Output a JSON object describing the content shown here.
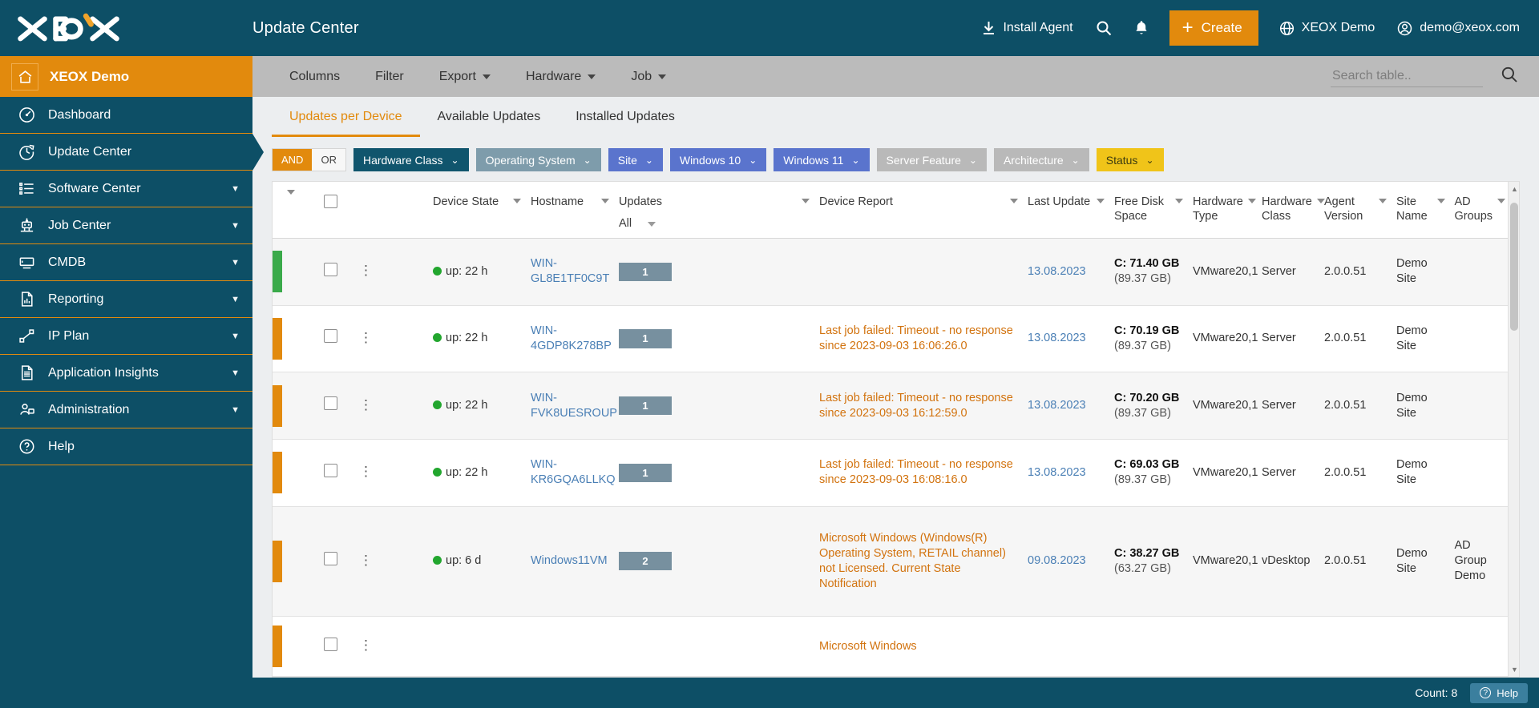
{
  "header": {
    "logo_text": "XEOX",
    "app_title": "Update Center",
    "install_agent": "Install Agent",
    "search_icon": "search-icon",
    "bell_icon": "notifications-icon",
    "create_label": "Create",
    "tenant_label": "XEOX Demo",
    "user_label": "demo@xeox.com"
  },
  "sidebar": {
    "tenant": "XEOX Demo",
    "items": [
      {
        "label": "Dashboard",
        "icon": "gauge-icon",
        "expandable": false,
        "active": false
      },
      {
        "label": "Update Center",
        "icon": "clock-refresh-icon",
        "expandable": false,
        "active": true
      },
      {
        "label": "Software Center",
        "icon": "list-icon",
        "expandable": true,
        "active": false
      },
      {
        "label": "Job Center",
        "icon": "robot-icon",
        "expandable": true,
        "active": false
      },
      {
        "label": "CMDB",
        "icon": "monitor-icon",
        "expandable": true,
        "active": false
      },
      {
        "label": "Reporting",
        "icon": "report-chart-icon",
        "expandable": true,
        "active": false
      },
      {
        "label": "IP Plan",
        "icon": "network-icon",
        "expandable": true,
        "active": false
      },
      {
        "label": "Application Insights",
        "icon": "document-icon",
        "expandable": true,
        "active": false
      },
      {
        "label": "Administration",
        "icon": "user-config-icon",
        "expandable": true,
        "active": false
      },
      {
        "label": "Help",
        "icon": "question-icon",
        "expandable": false,
        "active": false
      }
    ]
  },
  "toolbar": {
    "buttons": [
      {
        "label": "Columns",
        "caret": false
      },
      {
        "label": "Filter",
        "caret": false
      },
      {
        "label": "Export",
        "caret": true
      },
      {
        "label": "Hardware",
        "caret": true
      },
      {
        "label": "Job",
        "caret": true
      }
    ],
    "search_placeholder": "Search table..",
    "search_value": ""
  },
  "tabs": [
    {
      "label": "Updates per Device",
      "active": true
    },
    {
      "label": "Available Updates",
      "active": false
    },
    {
      "label": "Installed Updates",
      "active": false
    }
  ],
  "filters": {
    "and_label": "AND",
    "or_label": "OR",
    "active_operator": "AND",
    "chips": [
      {
        "label": "Hardware Class",
        "color": "#10556d"
      },
      {
        "label": "Operating System",
        "color": "#7e9cab"
      },
      {
        "label": "Site",
        "color": "#5a74cd"
      },
      {
        "label": "Windows 10",
        "color": "#5a74cd"
      },
      {
        "label": "Windows 11",
        "color": "#5a74cd"
      },
      {
        "label": "Server Feature",
        "color": "#b9b9b9"
      },
      {
        "label": "Architecture",
        "color": "#b9b9b9"
      },
      {
        "label": "Status",
        "color": "#f0c419"
      }
    ]
  },
  "table": {
    "columns": [
      {
        "label": "Device State",
        "caret": true
      },
      {
        "label": "Hostname",
        "caret": true
      },
      {
        "label": "Updates",
        "caret": true,
        "sub_value": "All",
        "sub_caret": true
      },
      {
        "label": "Device Report",
        "caret": true
      },
      {
        "label": "Last Update",
        "caret": true
      },
      {
        "label": "Free Disk Space",
        "caret": true
      },
      {
        "label": "Hardware Type",
        "caret": true
      },
      {
        "label": "Hardware Class",
        "caret": true
      },
      {
        "label": "Agent Version",
        "caret": true
      },
      {
        "label": "Site Name",
        "caret": true
      },
      {
        "label": "AD Groups",
        "caret": true
      }
    ],
    "rows": [
      {
        "state_color": "#3aaa4a",
        "status_dot": "#22a62e",
        "device_state": "up: 22 h",
        "hostname": "WIN-GL8E1TF0C9T",
        "updates": "1",
        "device_report": "",
        "last_update": "13.08.2023",
        "disk_used": "C: 71.40 GB",
        "disk_total": "(89.37 GB)",
        "hardware_type": "VMware20,1",
        "hardware_class": "Server",
        "agent_version": "2.0.0.51",
        "site_name": "Demo Site",
        "ad_groups": ""
      },
      {
        "state_color": "#e28a0d",
        "status_dot": "#22a62e",
        "device_state": "up: 22 h",
        "hostname": "WIN-4GDP8K278BP",
        "updates": "1",
        "device_report": "Last job failed: Timeout - no response since 2023-09-03 16:06:26.0",
        "last_update": "13.08.2023",
        "disk_used": "C: 70.19 GB",
        "disk_total": "(89.37 GB)",
        "hardware_type": "VMware20,1",
        "hardware_class": "Server",
        "agent_version": "2.0.0.51",
        "site_name": "Demo Site",
        "ad_groups": ""
      },
      {
        "state_color": "#e28a0d",
        "status_dot": "#22a62e",
        "device_state": "up: 22 h",
        "hostname": "WIN-FVK8UESROUP",
        "updates": "1",
        "device_report": "Last job failed: Timeout - no response since 2023-09-03 16:12:59.0",
        "last_update": "13.08.2023",
        "disk_used": "C: 70.20 GB",
        "disk_total": "(89.37 GB)",
        "hardware_type": "VMware20,1",
        "hardware_class": "Server",
        "agent_version": "2.0.0.51",
        "site_name": "Demo Site",
        "ad_groups": ""
      },
      {
        "state_color": "#e28a0d",
        "status_dot": "#22a62e",
        "device_state": "up: 22 h",
        "hostname": "WIN-KR6GQA6LLKQ",
        "updates": "1",
        "device_report": "Last job failed: Timeout - no response since 2023-09-03 16:08:16.0",
        "last_update": "13.08.2023",
        "disk_used": "C: 69.03 GB",
        "disk_total": "(89.37 GB)",
        "hardware_type": "VMware20,1",
        "hardware_class": "Server",
        "agent_version": "2.0.0.51",
        "site_name": "Demo Site",
        "ad_groups": ""
      },
      {
        "state_color": "#e28a0d",
        "status_dot": "#22a62e",
        "device_state": "up: 6 d",
        "hostname": "Windows11VM",
        "updates": "2",
        "device_report": "Microsoft Windows (Windows(R) Operating System, RETAIL channel) not Licensed. Current State Notification",
        "last_update": "09.08.2023",
        "disk_used": "C: 38.27 GB",
        "disk_total": "(63.27 GB)",
        "hardware_type": "VMware20,1",
        "hardware_class": "vDesktop",
        "agent_version": "2.0.0.51",
        "site_name": "Demo Site",
        "ad_groups": "AD Group Demo"
      },
      {
        "state_color": "#e28a0d",
        "status_dot": "#22a62e",
        "device_state": "",
        "hostname": "",
        "updates": "",
        "device_report": "Microsoft Windows",
        "last_update": "",
        "disk_used": "",
        "disk_total": "",
        "hardware_type": "",
        "hardware_class": "",
        "agent_version": "",
        "site_name": "",
        "ad_groups": ""
      }
    ]
  },
  "footer": {
    "count_label": "Count: 8",
    "help_label": "Help"
  }
}
